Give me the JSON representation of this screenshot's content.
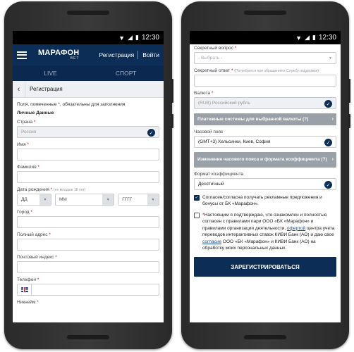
{
  "status": {
    "time": "12:30"
  },
  "left": {
    "appbar": {
      "logo_top": "МАРАФОН",
      "logo_bottom": "BET",
      "register": "Регистрация",
      "login": "Войти"
    },
    "tabs": [
      "LIVE",
      "СПОРТ"
    ],
    "subheader": {
      "title": "Регистрация"
    },
    "note": "Поля, помеченные *, обязательны для заполнения",
    "section": "Личные Данные",
    "fields": {
      "country": {
        "label": "Страна",
        "value": "Россия"
      },
      "name": {
        "label": "Имя"
      },
      "surname": {
        "label": "Фамилия"
      },
      "birthdate": {
        "label": "Дата рождения",
        "hint": "(не младше 18 лет)",
        "day": "ДД",
        "month": "ММ",
        "year": "ГГГГ"
      },
      "city": {
        "label": "Город"
      },
      "address": {
        "label": "Полный адрес"
      },
      "postcode": {
        "label": "Почтовый индекс"
      },
      "phone": {
        "label": "Телефон"
      },
      "nickname": {
        "label": "Никнейм"
      }
    }
  },
  "right": {
    "secret_question": {
      "label": "Секретный вопрос",
      "placeholder": "- Выбрать -"
    },
    "secret_answer": {
      "label": "Секретный ответ",
      "hint": "(Потребуется при обращении в Службу поддержки)"
    },
    "currency": {
      "label": "Валюта",
      "value": "(RUB) Российский рубль"
    },
    "payment_bar": "Платежные системы для выбранной валюты (?)",
    "timezone": {
      "label": "Часовой пояс",
      "value": "(GMT+3) Хельсинки, Киев, София"
    },
    "timezone_bar": "Изменение часового пояса и формата коэффициента (?)",
    "odds_format": {
      "label": "Формат коэффициента",
      "value": "Десятичный"
    },
    "consent_ads": "Согласен/согласна получать рекламные предложения и бонусы от БК «Марафон».",
    "consent_rules": {
      "part1": "Настоящим я подтверждаю, что ознакомлен и полностью согласен с правилами пари ООО «БК «Марафон» и правилами организации деятельности,",
      "offer": "офертой",
      "part2": "центра учета переводов интерактивных ставок КИВИ Банк (АО) и даю свое",
      "consent": "согласие",
      "part3": "ООО «БК «Марафон» и КИВИ Банк (АО) на обработку моих персональных данных."
    },
    "submit": "ЗАРЕГИСТРИРОВАТЬСЯ"
  },
  "colors": {
    "brand": "#0c2d55",
    "required": "#d0021b",
    "bar": "#9aa0a8"
  }
}
